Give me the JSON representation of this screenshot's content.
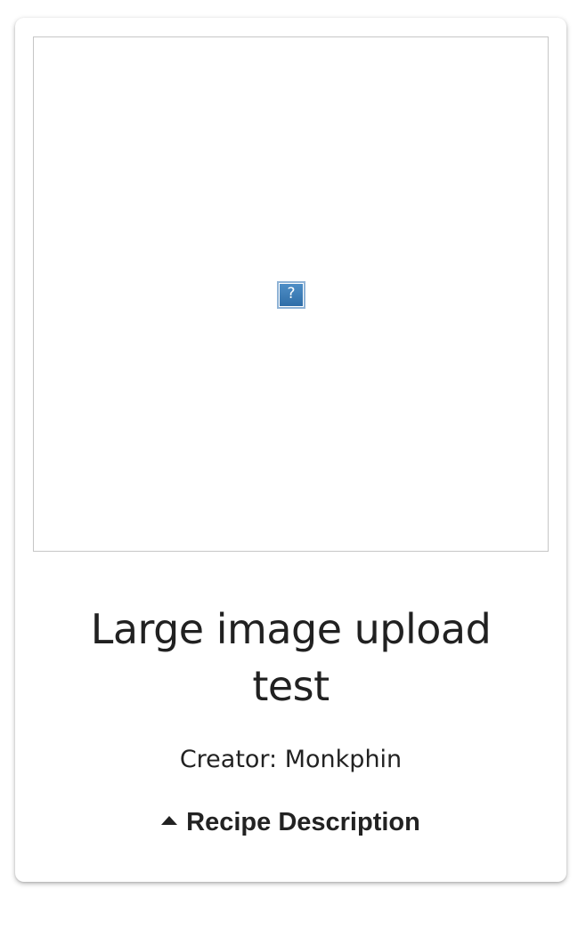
{
  "recipe": {
    "title": "Large image upload test",
    "creator_text": "Creator: Monkphin",
    "description_toggle_label": "Recipe Description",
    "image_placeholder_glyph": "?"
  },
  "icons": {
    "broken_image": "broken-image-icon",
    "toggle": "caret-up-icon"
  },
  "colors": {
    "text": "#222222",
    "card_background": "#ffffff",
    "image_border": "#c6c6c6",
    "broken_icon_blue": "#3f7fbb"
  }
}
